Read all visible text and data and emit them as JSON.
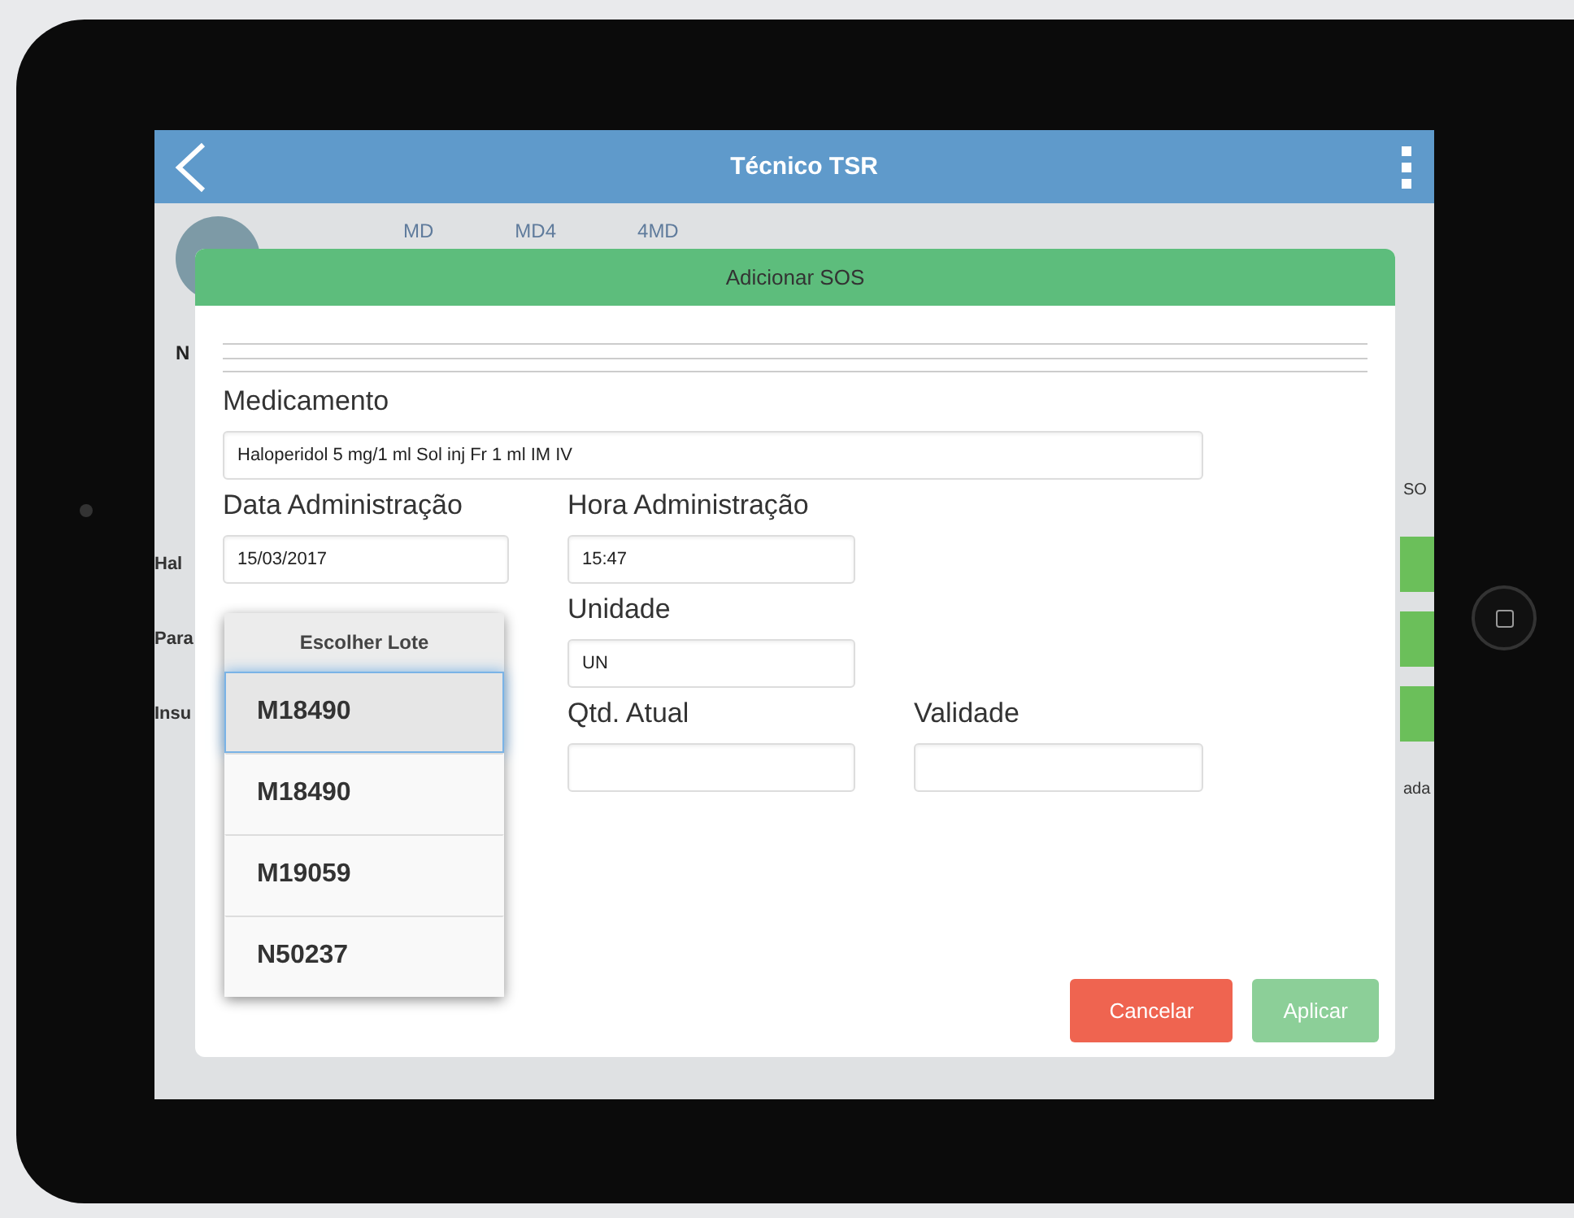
{
  "top_bar": {
    "title": "Técnico TSR"
  },
  "background": {
    "profile_initial": "N",
    "tabs": [
      "MD",
      "MD4",
      "4MD"
    ],
    "row_labels": [
      "Hal",
      "Para",
      "Insu"
    ],
    "side_texts": [
      "SO",
      "ada"
    ]
  },
  "dialog": {
    "title": "Adicionar SOS",
    "rows": [
      {
        "kind": "wide",
        "fields": [
          {
            "label": "Medicamento",
            "value": "Haloperidol 5 mg/1 ml Sol inj Fr 1 ml IM IV"
          }
        ]
      },
      {
        "kind": "full",
        "fields": [
          {
            "label": "Data Administração",
            "value": "15/03/2017"
          },
          {
            "label": "Hora Administração",
            "value": "15:47"
          }
        ]
      },
      {
        "kind": "indented",
        "fields": [
          {
            "label": "Unidade",
            "value": "UN"
          }
        ]
      },
      {
        "kind": "indented",
        "fields": [
          {
            "label": "Qtd. Atual"
          },
          {
            "label": "Validade"
          }
        ]
      }
    ],
    "picker": {
      "title": "Escolher Lote",
      "options": [
        {
          "label": "M18490",
          "selected": true
        },
        {
          "label": "M18490",
          "selected": false
        },
        {
          "label": "M19059",
          "selected": false
        },
        {
          "label": "N50237",
          "selected": false
        }
      ]
    },
    "buttons": [
      {
        "label": "Cancelar",
        "kind": "cancel"
      },
      {
        "label": "Aplicar",
        "kind": "apply"
      }
    ]
  }
}
